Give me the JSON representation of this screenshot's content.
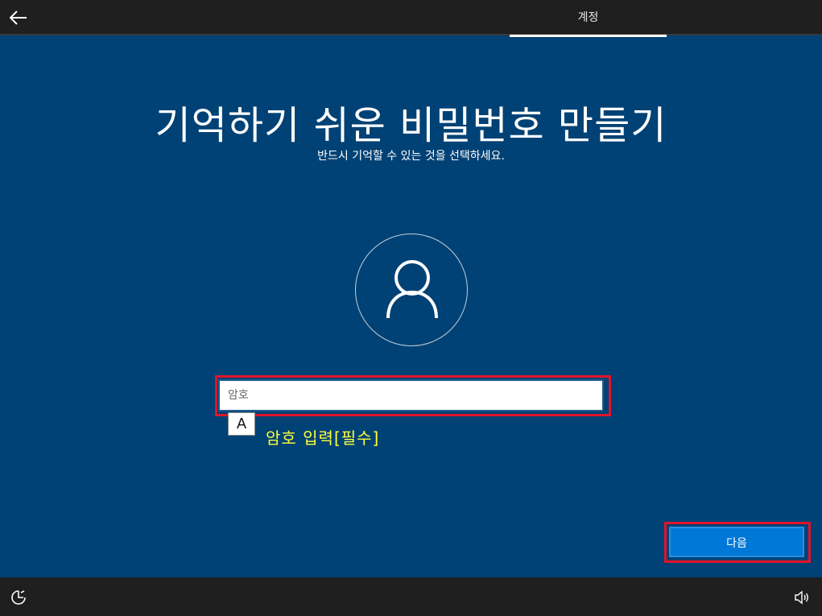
{
  "header": {
    "back_icon": "arrow-left-icon",
    "tab_label": "계정"
  },
  "main": {
    "title": "기억하기 쉬운 비밀번호 만들기",
    "subtitle": "반드시 기억할 수 있는 것을 선택하세요.",
    "avatar_icon": "user-icon",
    "password": {
      "value": "",
      "placeholder": "암호"
    },
    "annotation": {
      "marker": "A",
      "text": "암호 입력[필수]"
    },
    "next_label": "다음"
  },
  "footer": {
    "accessibility_icon": "ease-of-access-icon",
    "volume_icon": "volume-icon"
  },
  "colors": {
    "background": "#004275",
    "topbar": "#1f1f1f",
    "accent_button": "#0078d7",
    "highlight_border": "#e0142b",
    "annotation_text": "#ffff3c"
  }
}
